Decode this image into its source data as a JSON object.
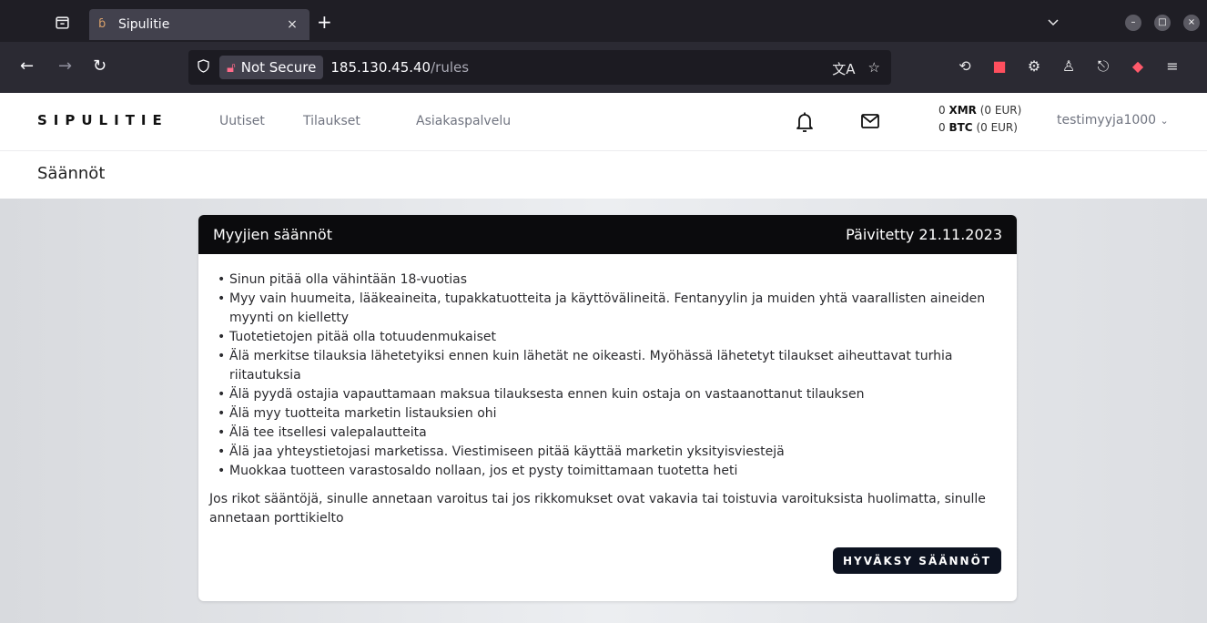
{
  "browser": {
    "tab_title": "Sipulitie",
    "tab_close": "×",
    "new_tab": "+",
    "url_security": "Not Secure",
    "url_host": "185.130.45.40",
    "url_path": "/rules"
  },
  "site": {
    "logo": "SIPULITIE",
    "nav": [
      "Uutiset",
      "Tilaukset",
      "Asiakaspalvelu"
    ],
    "wallet": {
      "xmr_amount": "0",
      "xmr_label": "XMR",
      "xmr_eur": "(0 EUR)",
      "btc_amount": "0",
      "btc_label": "BTC",
      "btc_eur": "(0 EUR)"
    },
    "username": "testimyyja1000"
  },
  "page": {
    "title": "Säännöt"
  },
  "card": {
    "title": "Myyjien säännöt",
    "updated": "Päivitetty 21.11.2023",
    "rules": [
      "Sinun pitää olla vähintään 18-vuotias",
      "Myy vain huumeita, lääkeaineita, tupakkatuotteita ja käyttövälineitä. Fentanyylin ja muiden yhtä vaarallisten aineiden myynti on kielletty",
      "Tuotetietojen pitää olla totuudenmukaiset",
      "Älä merkitse tilauksia lähetetyiksi ennen kuin lähetät ne oikeasti. Myöhässä lähetetyt tilaukset aiheuttavat turhia riitautuksia",
      "Älä pyydä ostajia vapauttamaan maksua tilauksesta ennen kuin ostaja on vastaanottanut tilauksen",
      "Älä myy tuotteita marketin listauksien ohi",
      "Älä tee itsellesi valepalautteita",
      "Älä jaa yhteystietojasi marketissa. Viestimiseen pitää käyttää marketin yksityisviestejä",
      "Muokkaa tuotteen varastosaldo nollaan, jos et pysty toimittamaan tuotetta heti"
    ],
    "footer": "Jos rikot sääntöjä, sinulle annetaan varoitus tai jos rikkomukset ovat vakavia tai toistuvia varoituksista huolimatta, sinulle annetaan porttikielto",
    "accept_button": "HYVÄKSY SÄÄNNÖT"
  }
}
